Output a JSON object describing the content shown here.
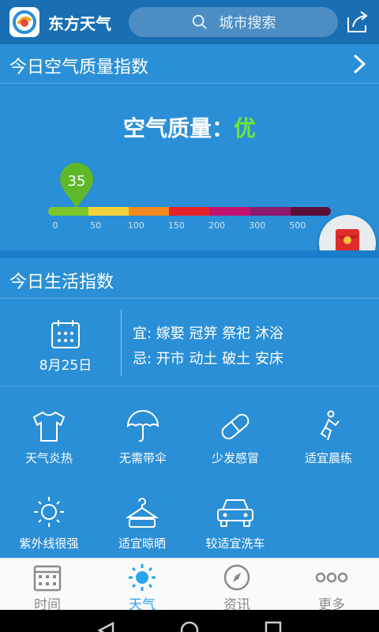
{
  "app": {
    "name": "东方天气",
    "search_placeholder": "城市搜索"
  },
  "aqi": {
    "title": "今日空气质量指数",
    "label": "空气质量：",
    "level": "优",
    "value": "35",
    "value_numeric": 35,
    "scale_max": 500,
    "ticks": [
      "0",
      "50",
      "100",
      "150",
      "200",
      "300",
      "500"
    ],
    "bar_colors": [
      "#7cc62c",
      "#f2d23a",
      "#f18a1e",
      "#e8212b",
      "#c1136f",
      "#8c1a6e",
      "#5c0f3a"
    ]
  },
  "life": {
    "title": "今日生活指数",
    "date": "8月25日",
    "yi": "宜: 嫁娶 冠笄 祭祀 沐浴",
    "ji": "忌: 开市 动土 破土 安床",
    "items": [
      {
        "label": "天气炎热",
        "icon": "tshirt-icon"
      },
      {
        "label": "无需带伞",
        "icon": "umbrella-icon"
      },
      {
        "label": "少发感冒",
        "icon": "pill-icon"
      },
      {
        "label": "适宜晨练",
        "icon": "exercise-icon"
      },
      {
        "label": "紫外线很强",
        "icon": "sun-icon"
      },
      {
        "label": "适宜晾晒",
        "icon": "hanger-icon"
      },
      {
        "label": "较适宜洗车",
        "icon": "car-icon"
      }
    ]
  },
  "tabs": [
    {
      "label": "时间",
      "icon": "calendar-icon",
      "active": false
    },
    {
      "label": "天气",
      "icon": "sun-icon",
      "active": true
    },
    {
      "label": "资讯",
      "icon": "compass-icon",
      "active": false
    },
    {
      "label": "更多",
      "icon": "more-dots-icon",
      "active": false
    }
  ],
  "colors": {
    "accent_green": "#6ee43a",
    "active_tab": "#29a3ee",
    "panel": "#2a8fd6",
    "topbar": "#1a6fb3"
  }
}
